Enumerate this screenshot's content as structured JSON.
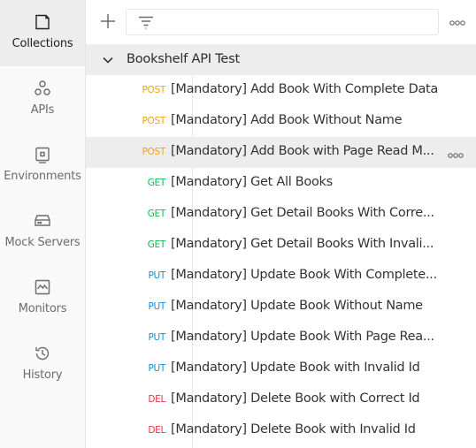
{
  "sidebar": {
    "items": [
      {
        "label": "Collections",
        "icon": "collections-icon",
        "active": true
      },
      {
        "label": "APIs",
        "icon": "apis-icon"
      },
      {
        "label": "Environments",
        "icon": "environments-icon"
      },
      {
        "label": "Mock Servers",
        "icon": "mock-servers-icon"
      },
      {
        "label": "Monitors",
        "icon": "monitors-icon"
      },
      {
        "label": "History",
        "icon": "history-icon"
      }
    ]
  },
  "toolbar": {
    "filter_value": "",
    "filter_placeholder": ""
  },
  "collection": {
    "name": "Bookshelf API Test",
    "expanded": true
  },
  "requests": [
    {
      "method": "POST",
      "name": "[Mandatory] Add Book With Complete Data"
    },
    {
      "method": "POST",
      "name": "[Mandatory] Add Book Without Name"
    },
    {
      "method": "POST",
      "name": "[Mandatory] Add Book with Page Read M...",
      "hover": true
    },
    {
      "method": "GET",
      "name": "[Mandatory] Get All Books"
    },
    {
      "method": "GET",
      "name": "[Mandatory] Get Detail Books With Corre..."
    },
    {
      "method": "GET",
      "name": "[Mandatory] Get Detail Books With Invali..."
    },
    {
      "method": "PUT",
      "name": "[Mandatory] Update Book With Complete..."
    },
    {
      "method": "PUT",
      "name": "[Mandatory] Update Book Without Name"
    },
    {
      "method": "PUT",
      "name": "[Mandatory] Update Book With Page Rea..."
    },
    {
      "method": "PUT",
      "name": "[Mandatory] Update Book with Invalid Id"
    },
    {
      "method": "DEL",
      "name": "[Mandatory] Delete Book with Correct Id"
    },
    {
      "method": "DEL",
      "name": "[Mandatory] Delete Book with Invalid Id"
    }
  ],
  "colors": {
    "POST": "#f2a600",
    "GET": "#0cbb52",
    "PUT": "#0f8fdb",
    "DEL": "#e8363d"
  }
}
